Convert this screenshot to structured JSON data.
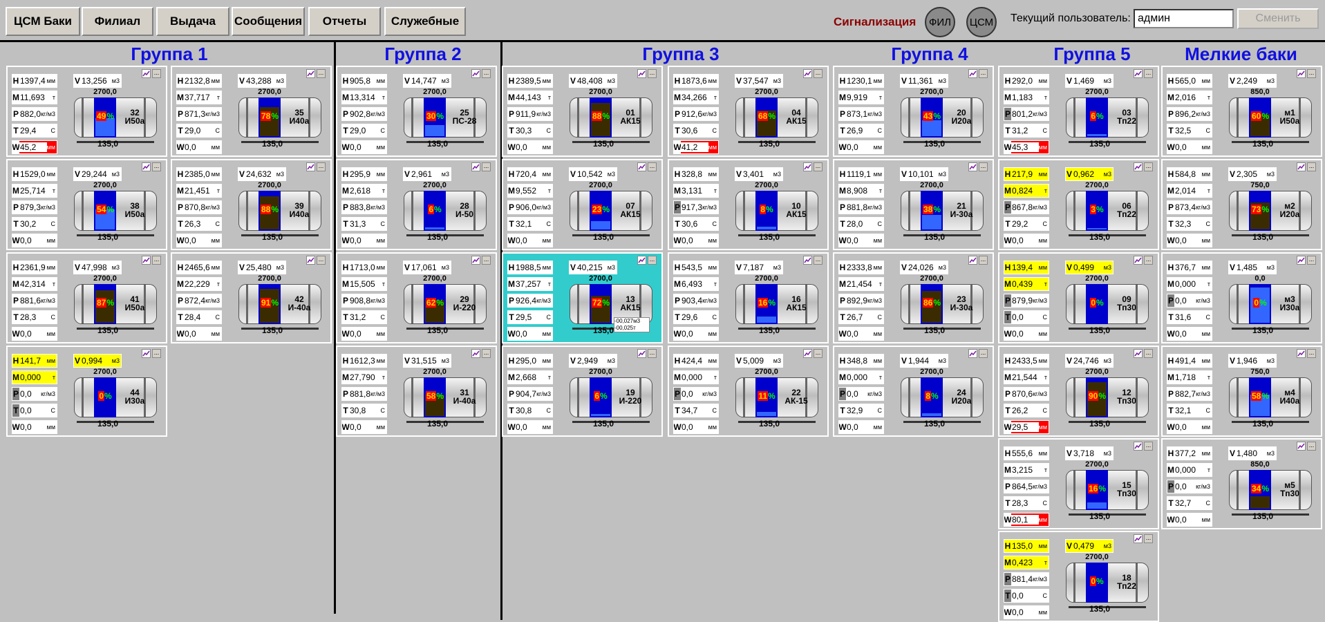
{
  "menu": [
    "ЦСМ Баки",
    "Филиал",
    "Выдача",
    "Сообщения",
    "Отчеты",
    "Служебные"
  ],
  "alarm_label": "Сигнализация",
  "circles": [
    "ФИЛ",
    "ЦСМ"
  ],
  "user_label": "Текущий пользователь:",
  "user_value": "админ",
  "change_label": "Сменить",
  "groups": [
    "Группа 1",
    "Группа 2",
    "Группа 3",
    "Группа 4",
    "Группа 5",
    "Мелкие баки"
  ],
  "units": {
    "H": "мм",
    "M": "т",
    "P": "кг/м3",
    "T": "С",
    "W": "мм",
    "V": "м3"
  },
  "tanks": [
    {
      "col": 0,
      "row": 0,
      "H": "1397,4",
      "V": "13,256",
      "M": "11,693",
      "P": "882,0",
      "T": "29,4",
      "W": "45,2",
      "W_red": true,
      "hmax": "2700,0",
      "base": "135,0",
      "pct": "49",
      "level": 0.49,
      "dark": 0,
      "num": "32",
      "prod": "И50а"
    },
    {
      "col": 1,
      "row": 0,
      "H": "2132,8",
      "V": "43,288",
      "M": "37,717",
      "P": "871,3",
      "T": "29,0",
      "W": "0,0",
      "hmax": "2700,0",
      "base": "135,0",
      "pct": "78",
      "level": 0.78,
      "dark": 0.78,
      "num": "35",
      "prod": "И40а"
    },
    {
      "col": 0,
      "row": 1,
      "H": "1529,0",
      "V": "29,244",
      "M": "25,714",
      "P": "879,3",
      "T": "30,2",
      "W": "0,0",
      "hmax": "2700,0",
      "base": "135,0",
      "pct": "54",
      "level": 0.54,
      "dark": 0,
      "num": "38",
      "prod": "И50а"
    },
    {
      "col": 1,
      "row": 1,
      "H": "2385,0",
      "V": "24,632",
      "M": "21,451",
      "P": "870,8",
      "T": "26,3",
      "W": "0,0",
      "hmax": "2700,0",
      "base": "135,0",
      "pct": "88",
      "level": 0.88,
      "dark": 0.88,
      "num": "39",
      "prod": "И40а"
    },
    {
      "col": 0,
      "row": 2,
      "H": "2361,9",
      "V": "47,998",
      "M": "42,314",
      "P": "881,6",
      "T": "28,3",
      "W": "0,0",
      "hmax": "2700,0",
      "base": "135,0",
      "pct": "87",
      "level": 0.87,
      "dark": 0.87,
      "num": "41",
      "prod": "И50а"
    },
    {
      "col": 1,
      "row": 2,
      "H": "2465,6",
      "V": "25,480",
      "M": "22,229",
      "P": "872,4",
      "T": "28,4",
      "W": "0,0",
      "hmax": "2700,0",
      "base": "135,0",
      "pct": "91",
      "level": 0.91,
      "dark": 0.91,
      "num": "42",
      "prod": "И-40а"
    },
    {
      "col": 0,
      "row": 3,
      "H": "141,7",
      "V": "0,994",
      "M": "0,000",
      "P": "0,0",
      "T": "0,0",
      "W": "0,0",
      "yellow": true,
      "grey": true,
      "hmax": "2700,0",
      "base": "135,0",
      "pct": "0",
      "level": 0,
      "dark": 0,
      "num": "44",
      "prod": "И30а"
    },
    {
      "col": 2,
      "row": 0,
      "H": "905,8",
      "V": "14,747",
      "M": "13,314",
      "P": "902,8",
      "T": "29,0",
      "W": "0,0",
      "hmax": "2700,0",
      "base": "135,0",
      "pct": "30",
      "level": 0.3,
      "dark": 0,
      "num": "25",
      "prod": "ПС-28"
    },
    {
      "col": 2,
      "row": 1,
      "H": "295,9",
      "V": "2,961",
      "M": "2,618",
      "P": "883,8",
      "T": "31,3",
      "W": "0,0",
      "hmax": "2700,0",
      "base": "135,0",
      "pct": "6",
      "level": 0.06,
      "dark": 0,
      "num": "28",
      "prod": "И-50"
    },
    {
      "col": 2,
      "row": 2,
      "H": "1713,0",
      "V": "17,061",
      "M": "15,505",
      "P": "908,8",
      "T": "31,2",
      "W": "0,0",
      "hmax": "2700,0",
      "base": "135,0",
      "pct": "62",
      "level": 0.62,
      "dark": 0.62,
      "num": "29",
      "prod": "И-220"
    },
    {
      "col": 2,
      "row": 3,
      "H": "1612,3",
      "V": "31,515",
      "M": "27,790",
      "P": "881,8",
      "T": "30,8",
      "W": "0,0",
      "hmax": "2700,0",
      "base": "135,0",
      "pct": "58",
      "level": 0.58,
      "dark": 0.58,
      "num": "31",
      "prod": "И-40а"
    },
    {
      "col": 3,
      "row": 0,
      "H": "2389,5",
      "V": "48,408",
      "M": "44,143",
      "P": "911,9",
      "T": "30,3",
      "W": "0,0",
      "hmax": "2700,0",
      "base": "135,0",
      "pct": "88",
      "level": 0.88,
      "dark": 0.88,
      "num": "01",
      "prod": "АК15"
    },
    {
      "col": 3,
      "row": 1,
      "H": "720,4",
      "V": "10,542",
      "M": "9,552",
      "P": "906,0",
      "T": "32,1",
      "W": "0,0",
      "hmax": "2700,0",
      "base": "135,0",
      "pct": "23",
      "level": 0.23,
      "dark": 0,
      "num": "07",
      "prod": "АК15"
    },
    {
      "col": 3,
      "row": 2,
      "H": "1988,5",
      "V": "40,215",
      "M": "37,257",
      "P": "926,4",
      "T": "29,5",
      "W": "0,0",
      "highlight": true,
      "hmax": "2700,0",
      "base": "135,0",
      "pct": "72",
      "level": 0.72,
      "dark": 0.72,
      "num": "13",
      "prod": "АК15",
      "note1": "-00,027м3",
      "note2": "-00,025т"
    },
    {
      "col": 3,
      "row": 3,
      "H": "295,0",
      "V": "2,949",
      "M": "2,668",
      "P": "904,7",
      "T": "30,8",
      "W": "0,0",
      "hmax": "2700,0",
      "base": "135,0",
      "pct": "6",
      "level": 0.06,
      "dark": 0,
      "num": "19",
      "prod": "И-220"
    },
    {
      "col": 4,
      "row": 0,
      "H": "1873,6",
      "V": "37,547",
      "M": "34,266",
      "P": "912,6",
      "T": "30,6",
      "W": "41,2",
      "W_red": true,
      "hmax": "2700,0",
      "base": "135,0",
      "pct": "68",
      "level": 0.68,
      "dark": 0.68,
      "num": "04",
      "prod": "АК15"
    },
    {
      "col": 4,
      "row": 1,
      "H": "328,8",
      "V": "3,401",
      "M": "3,131",
      "P": "917,3",
      "P_grey": true,
      "T": "30,6",
      "W": "0,0",
      "hmax": "2700,0",
      "base": "135,0",
      "pct": "8",
      "level": 0.08,
      "dark": 0,
      "num": "10",
      "prod": "АК15"
    },
    {
      "col": 4,
      "row": 2,
      "H": "543,5",
      "V": "7,187",
      "M": "6,493",
      "P": "903,4",
      "T": "29,6",
      "W": "0,0",
      "hmax": "2700,0",
      "base": "135,0",
      "pct": "16",
      "level": 0.16,
      "dark": 0,
      "num": "16",
      "prod": "АК15"
    },
    {
      "col": 4,
      "row": 3,
      "H": "424,4",
      "V": "5,009",
      "M": "0,000",
      "P": "0,0",
      "P_grey": true,
      "T": "34,7",
      "W": "0,0",
      "hmax": "2700,0",
      "base": "135,0",
      "pct": "11",
      "level": 0.11,
      "dark": 0,
      "num": "22",
      "prod": "АК-15"
    },
    {
      "col": 5,
      "row": 0,
      "H": "1230,1",
      "V": "11,361",
      "M": "9,919",
      "P": "873,1",
      "T": "26,9",
      "W": "0,0",
      "hmax": "2700,0",
      "base": "135,0",
      "pct": "43",
      "level": 0.43,
      "dark": 0,
      "num": "20",
      "prod": "И20а"
    },
    {
      "col": 5,
      "row": 1,
      "H": "1119,1",
      "V": "10,101",
      "M": "8,908",
      "P": "881,8",
      "T": "28,0",
      "W": "0,0",
      "hmax": "2700,0",
      "base": "135,0",
      "pct": "38",
      "level": 0.38,
      "dark": 0,
      "num": "21",
      "prod": "И-30а"
    },
    {
      "col": 5,
      "row": 2,
      "H": "2333,8",
      "V": "24,026",
      "M": "21,454",
      "P": "892,9",
      "T": "26,7",
      "W": "0,0",
      "hmax": "2700,0",
      "base": "135,0",
      "pct": "86",
      "level": 0.86,
      "dark": 0.86,
      "num": "23",
      "prod": "И-30а"
    },
    {
      "col": 5,
      "row": 3,
      "H": "348,8",
      "V": "1,944",
      "M": "0,000",
      "P": "0,0",
      "P_grey": true,
      "T": "32,9",
      "W": "0,0",
      "hmax": "2700,0",
      "base": "135,0",
      "pct": "8",
      "level": 0.08,
      "dark": 0,
      "num": "24",
      "prod": "И20а"
    },
    {
      "col": 6,
      "row": 0,
      "H": "292,0",
      "V": "1,469",
      "M": "1,183",
      "P": "801,2",
      "P_grey": true,
      "T": "31,2",
      "W": "45,3",
      "W_red": true,
      "hmax": "2700,0",
      "base": "135,0",
      "pct": "6",
      "level": 0.06,
      "dark": 0,
      "num": "03",
      "prod": "Тп22"
    },
    {
      "col": 6,
      "row": 1,
      "H": "217,9",
      "V": "0,962",
      "M": "0,824",
      "P": "867,8",
      "T": "29,2",
      "W": "0,0",
      "yellow": true,
      "P_grey": true,
      "hmax": "2700,0",
      "base": "135,0",
      "pct": "3",
      "level": 0.03,
      "dark": 0,
      "num": "06",
      "prod": "Тп22"
    },
    {
      "col": 6,
      "row": 2,
      "H": "139,4",
      "V": "0,499",
      "M": "0,439",
      "P": "879,9",
      "T": "0,0",
      "W": "0,0",
      "yellow": true,
      "grey": true,
      "hmax": "2700,0",
      "base": "135,0",
      "pct": "0",
      "level": 0,
      "dark": 0,
      "num": "09",
      "prod": "Тп30"
    },
    {
      "col": 6,
      "row": 3,
      "H": "2433,5",
      "V": "24,746",
      "M": "21,544",
      "P": "870,6",
      "T": "26,2",
      "W": "29,5",
      "W_red": true,
      "hmax": "2700,0",
      "base": "135,0",
      "pct": "90",
      "level": 0.9,
      "dark": 0.9,
      "num": "12",
      "prod": "Тп30"
    },
    {
      "col": 6,
      "row": 4,
      "H": "555,6",
      "V": "3,718",
      "M": "3,215",
      "P": "864,5",
      "T": "28,3",
      "W": "80,1",
      "W_red": true,
      "hmax": "2700,0",
      "base": "135,0",
      "pct": "16",
      "level": 0.16,
      "dark": 0,
      "num": "15",
      "prod": "Тп30"
    },
    {
      "col": 6,
      "row": 5,
      "H": "135,0",
      "V": "0,479",
      "M": "0,423",
      "P": "881,4",
      "T": "0,0",
      "W": "0,0",
      "yellow": true,
      "grey": true,
      "hmax": "2700,0",
      "base": "135,0",
      "pct": "0",
      "level": 0,
      "dark": 0,
      "num": "18",
      "prod": "Тп22"
    },
    {
      "col": 7,
      "row": 0,
      "H": "565,0",
      "V": "2,249",
      "M": "2,016",
      "P": "896,2",
      "T": "32,5",
      "W": "0,0",
      "hmax": "850,0",
      "base": "135,0",
      "pct": "60",
      "level": 0.6,
      "dark": 0.6,
      "num": "м1",
      "prod": "И50а"
    },
    {
      "col": 7,
      "row": 1,
      "H": "584,8",
      "V": "2,305",
      "M": "2,014",
      "P": "873,4",
      "T": "32,3",
      "W": "0,0",
      "hmax": "750,0",
      "base": "135,0",
      "pct": "73",
      "level": 0.73,
      "dark": 0.73,
      "num": "м2",
      "prod": "И20а"
    },
    {
      "col": 7,
      "row": 2,
      "H": "376,7",
      "V": "1,485",
      "M": "0,000",
      "P": "0,0",
      "P_grey": true,
      "T": "31,6",
      "W": "0,0",
      "hmax": "0,0",
      "base": "135,0",
      "pct": "0",
      "level": 0.95,
      "dark": 0,
      "num": "м3",
      "prod": "И30а"
    },
    {
      "col": 7,
      "row": 3,
      "H": "491,4",
      "V": "1,946",
      "M": "1,718",
      "P": "882,7",
      "T": "32,1",
      "W": "0,0",
      "hmax": "750,0",
      "base": "135,0",
      "pct": "58",
      "level": 0.58,
      "dark": 0,
      "num": "м4",
      "prod": "И40а"
    },
    {
      "col": 7,
      "row": 4,
      "H": "377,2",
      "V": "1,480",
      "M": "0,000",
      "P": "0,0",
      "P_grey": true,
      "T": "32,7",
      "W": "0,0",
      "hmax": "850,0",
      "base": "135,0",
      "pct": "34",
      "level": 0.34,
      "dark": 0.34,
      "num": "м5",
      "prod": "Тп30"
    }
  ]
}
